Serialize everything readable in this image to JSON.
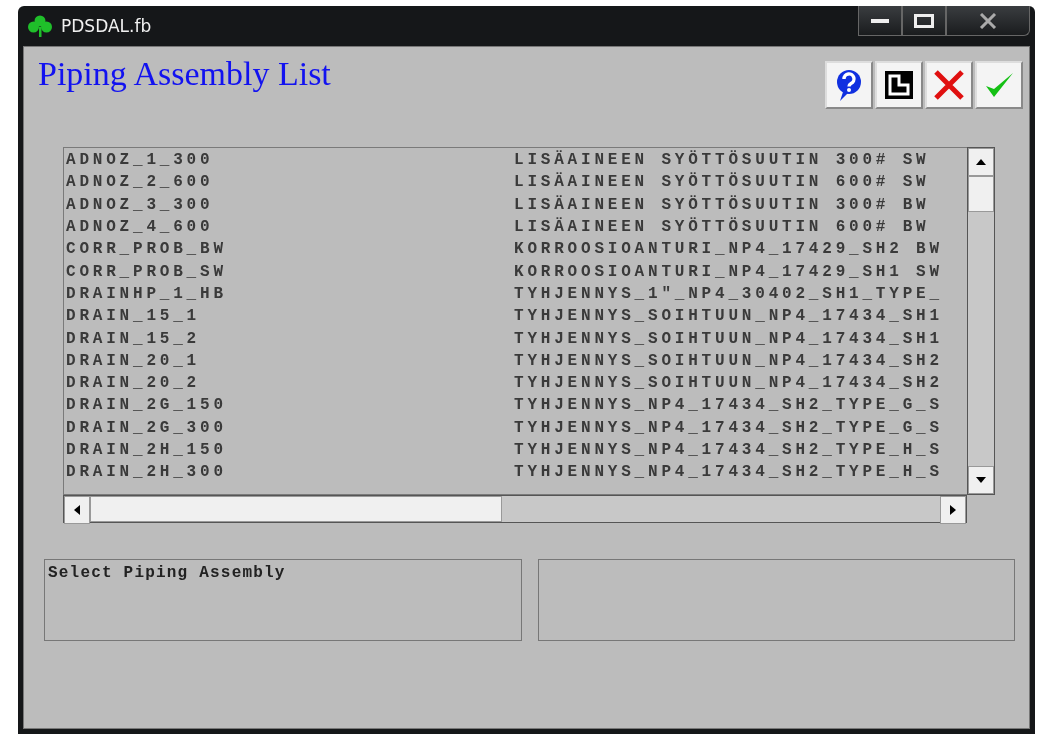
{
  "window": {
    "title": "PDSDAL.fb"
  },
  "header": {
    "title": "Piping Assembly List"
  },
  "toolbar": [
    {
      "kind": "help"
    },
    {
      "kind": "layout"
    },
    {
      "kind": "cancel"
    },
    {
      "kind": "ok"
    }
  ],
  "list": {
    "rows": [
      {
        "name": "ADNOZ_1_300",
        "description": "LISÄAINEEN SYÖTTÖSUUTIN 300# SW"
      },
      {
        "name": "ADNOZ_2_600",
        "description": "LISÄAINEEN SYÖTTÖSUUTIN 600# SW"
      },
      {
        "name": "ADNOZ_3_300",
        "description": "LISÄAINEEN SYÖTTÖSUUTIN 300# BW"
      },
      {
        "name": "ADNOZ_4_600",
        "description": "LISÄAINEEN SYÖTTÖSUUTIN 600# BW"
      },
      {
        "name": "CORR_PROB_BW",
        "description": "KORROOSIOANTURI_NP4_17429_SH2 BW"
      },
      {
        "name": "CORR_PROB_SW",
        "description": "KORROOSIOANTURI_NP4_17429_SH1 SW"
      },
      {
        "name": "DRAINHP_1_HB",
        "description": "TYHJENNYS_1\"_NP4_30402_SH1_TYPE_"
      },
      {
        "name": "DRAIN_15_1",
        "description": "TYHJENNYS_SOIHTUUN_NP4_17434_SH1"
      },
      {
        "name": "DRAIN_15_2",
        "description": "TYHJENNYS_SOIHTUUN_NP4_17434_SH1"
      },
      {
        "name": "DRAIN_20_1",
        "description": "TYHJENNYS_SOIHTUUN_NP4_17434_SH2"
      },
      {
        "name": "DRAIN_20_2",
        "description": "TYHJENNYS_SOIHTUUN_NP4_17434_SH2"
      },
      {
        "name": "DRAIN_2G_150",
        "description": "TYHJENNYS_NP4_17434_SH2_TYPE_G_S"
      },
      {
        "name": "DRAIN_2G_300",
        "description": "TYHJENNYS_NP4_17434_SH2_TYPE_G_S"
      },
      {
        "name": "DRAIN_2H_150",
        "description": "TYHJENNYS_NP4_17434_SH2_TYPE_H_S"
      },
      {
        "name": "DRAIN_2H_300",
        "description": "TYHJENNYS_NP4_17434_SH2_TYPE_H_S"
      }
    ]
  },
  "status": {
    "message": "Select Piping Assembly"
  }
}
